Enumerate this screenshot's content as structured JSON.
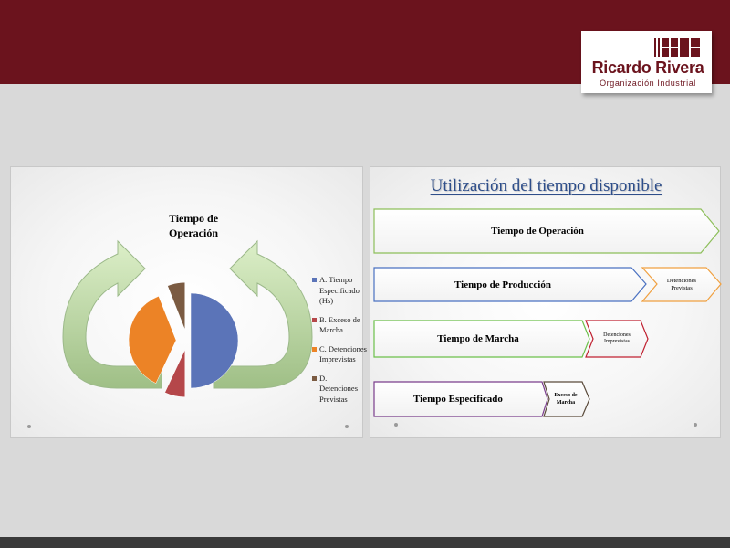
{
  "brand": {
    "name": "Ricardo Rivera",
    "subtitle": "Organización Industrial",
    "color": "#6b131d"
  },
  "left_slide": {
    "chart_data": {
      "type": "pie",
      "title": "Tiempo de Operación",
      "categories": [
        "A. Tiempo Especificado (Hs)",
        "B. Exceso de Marcha",
        "C. Detenciones Imprevistas",
        "D. Detenciones Previstas"
      ],
      "values": [
        50,
        7,
        37,
        6
      ],
      "colors": [
        "#5b74b8",
        "#b5474a",
        "#ec8326",
        "#7b5b42"
      ],
      "legend_position": "right",
      "exploded": true
    },
    "legend": [
      {
        "label": "A. Tiempo Especificado (Hs)",
        "color": "#5b74b8"
      },
      {
        "label": "B. Exceso de Marcha",
        "color": "#b5474a"
      },
      {
        "label": "C. Detenciones Imprevistas",
        "color": "#ec8326"
      },
      {
        "label": "D. Detenciones Previstas",
        "color": "#7b5b42"
      }
    ],
    "arrow_color": "#b7d39d"
  },
  "right_slide": {
    "title": "Utilización del tiempo disponible",
    "chevrons": {
      "operacion": {
        "label": "Tiempo de Operación",
        "color": "#8dbf5a"
      },
      "produccion": {
        "label": "Tiempo de Producción",
        "color": "#4a71c1"
      },
      "det_previstas": {
        "label": "Detenciones Previstas",
        "color": "#f0a040"
      },
      "marcha": {
        "label": "Tiempo de Marcha",
        "color": "#6cc04a"
      },
      "det_imprevistas": {
        "label": "Detenciones Imprevistas",
        "color": "#c02030"
      },
      "especificado": {
        "label": "Tiempo Especificado",
        "color": "#7a3d8c"
      },
      "exceso": {
        "label": "Exceso de Marcha",
        "color": "#5a4a3a"
      }
    }
  }
}
